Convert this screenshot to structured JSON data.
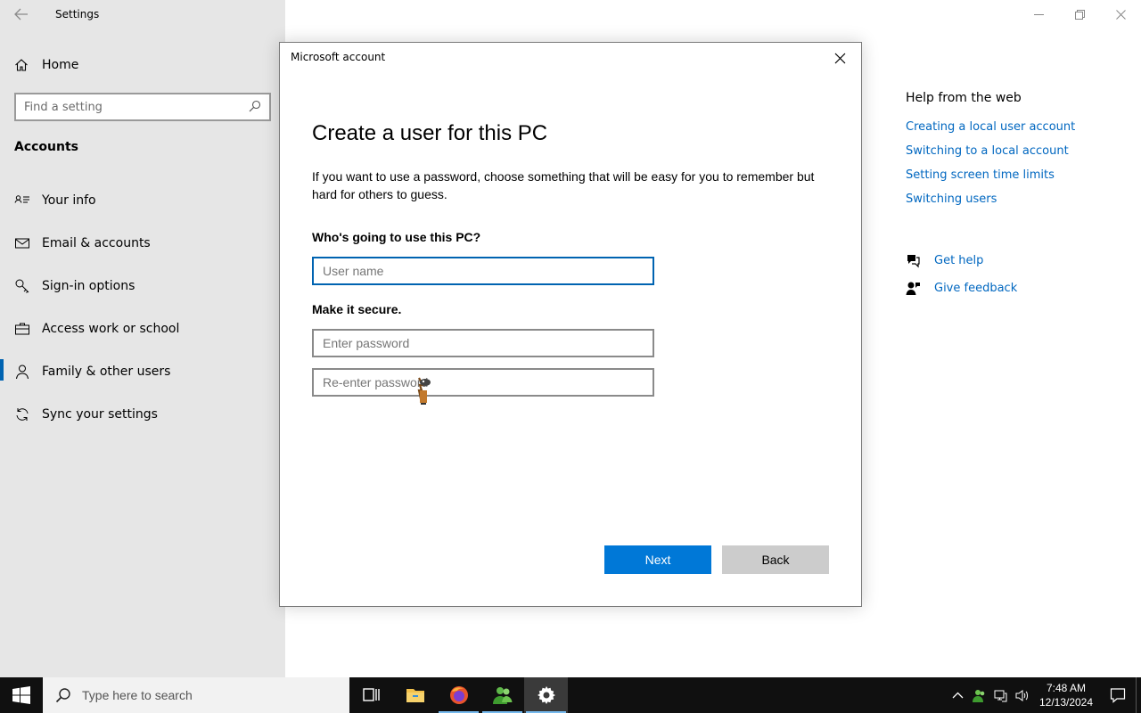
{
  "window": {
    "title": "Settings",
    "controls": [
      "minimize",
      "restore",
      "close"
    ]
  },
  "sidebar": {
    "home_label": "Home",
    "search_placeholder": "Find a setting",
    "section_title": "Accounts",
    "items": [
      {
        "label": "Your info",
        "icon": "contact-card-icon"
      },
      {
        "label": "Email & accounts",
        "icon": "mail-icon"
      },
      {
        "label": "Sign-in options",
        "icon": "key-icon"
      },
      {
        "label": "Access work or school",
        "icon": "briefcase-icon"
      },
      {
        "label": "Family & other users",
        "icon": "person-icon",
        "active": true
      },
      {
        "label": "Sync your settings",
        "icon": "sync-icon"
      }
    ]
  },
  "help": {
    "heading": "Help from the web",
    "links": [
      "Creating a local user account",
      "Switching to a local account",
      "Setting screen time limits",
      "Switching users"
    ],
    "get_help": "Get help",
    "give_feedback": "Give feedback"
  },
  "dialog": {
    "title": "Microsoft account",
    "heading": "Create a user for this PC",
    "description": "If you want to use a password, choose something that will be easy for you to remember but hard for others to guess.",
    "who_label": "Who's going to use this PC?",
    "username_placeholder": "User name",
    "username_value": "",
    "secure_label": "Make it secure.",
    "password_placeholder": "Enter password",
    "reenter_placeholder": "Re-enter password",
    "next_label": "Next",
    "back_label": "Back"
  },
  "taskbar": {
    "search_placeholder": "Type here to search",
    "apps": [
      "task-view",
      "file-explorer",
      "firefox",
      "people-app",
      "settings"
    ],
    "time": "7:48 AM",
    "date": "12/13/2024"
  },
  "colors": {
    "accent": "#0078d7",
    "link": "#0067c0",
    "sidebar_bg": "#e6e6e6",
    "taskbar_bg": "#101010"
  }
}
